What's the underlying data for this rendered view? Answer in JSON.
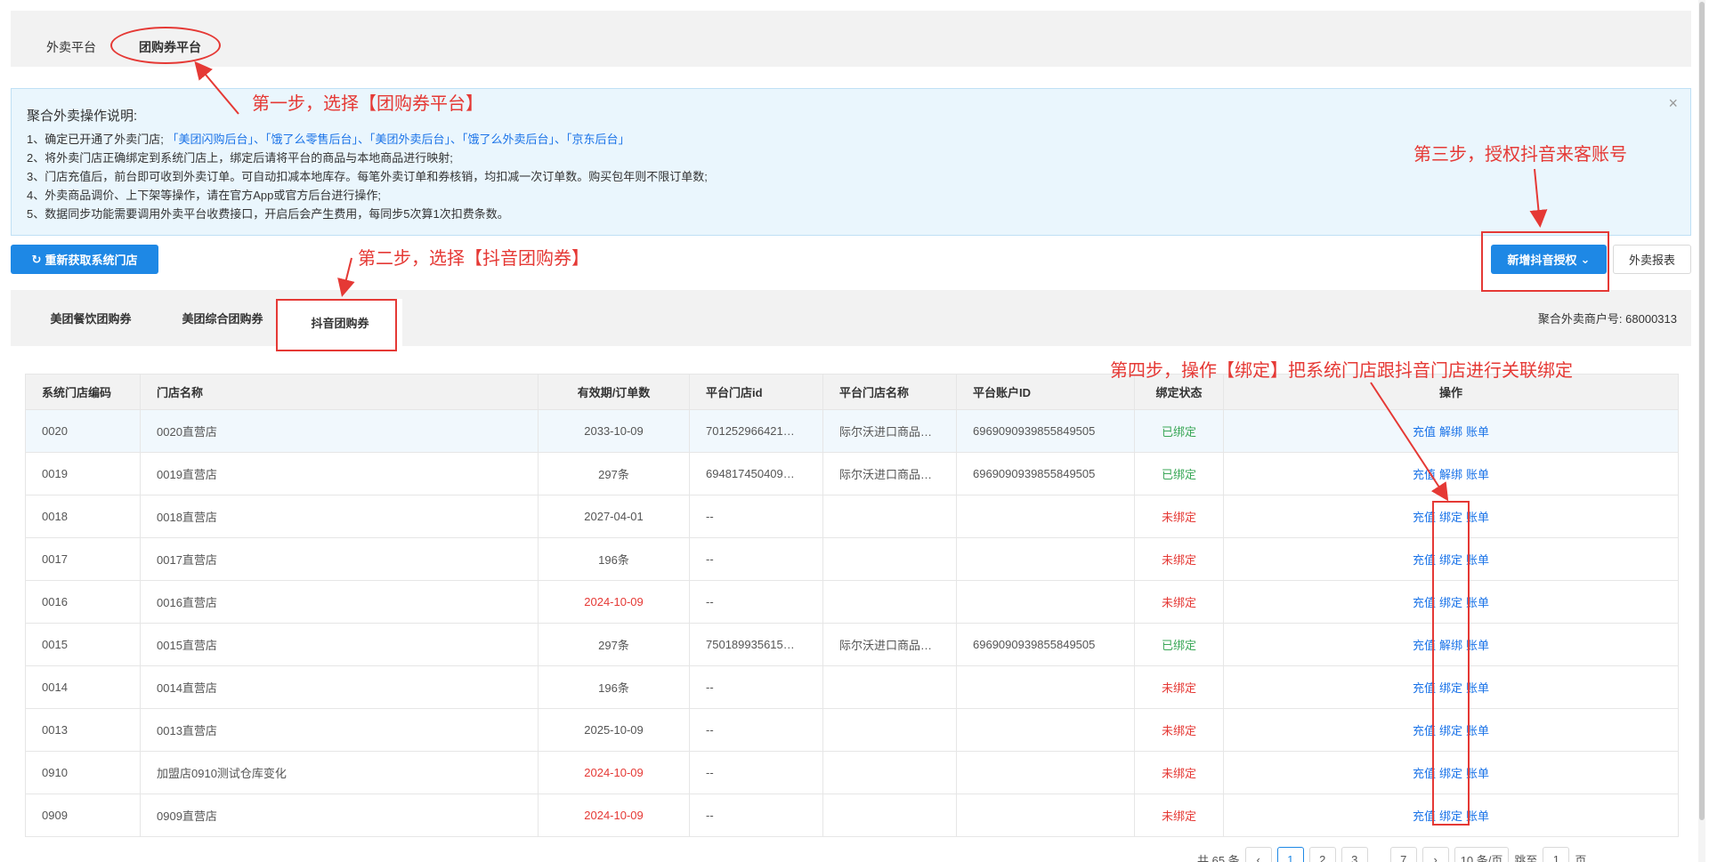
{
  "top_tabs": {
    "waimai": "外卖平台",
    "tuangou": "团购券平台"
  },
  "notice": {
    "title": "聚合外卖操作说明:",
    "close": "×",
    "line1_prefix": "1、确定已开通了外卖门店;",
    "line1_links": "「美团闪购后台」、「饿了么零售后台」、「美团外卖后台」、「饿了么外卖后台」、「京东后台」",
    "line2": "2、将外卖门店正确绑定到系统门店上，绑定后请将平台的商品与本地商品进行映射;",
    "line3": "3、门店充值后，前台即可收到外卖订单。可自动扣减本地库存。每笔外卖订单和券核销，均扣减一次订单数。购买包年则不限订单数;",
    "line4": "4、外卖商品调价、上下架等操作，请在官方App或官方后台进行操作;",
    "line5": "5、数据同步功能需要调用外卖平台收费接口，开启后会产生费用，每同步5次算1次扣费条数。"
  },
  "buttons": {
    "refresh": "重新获取系统门店",
    "add_auth": "新增抖音授权",
    "report": "外卖报表"
  },
  "sub_tabs": {
    "meituan_food": "美团餐饮团购券",
    "meituan_all": "美团综合团购券",
    "douyin": "抖音团购券"
  },
  "merchant_label": "聚合外卖商户号: 68000313",
  "table": {
    "headers": [
      "系统门店编码",
      "门店名称",
      "有效期/订单数",
      "平台门店id",
      "平台门店名称",
      "平台账户ID",
      "绑定状态",
      "操作"
    ],
    "rows": [
      {
        "code": "0020",
        "name": "0020直营店",
        "validity": "2033-10-09",
        "validity_red": false,
        "pid": "701252966421…",
        "pname": "际尔沃进口商品…",
        "acct": "6969090939855849505",
        "status": "已绑定",
        "bound": true
      },
      {
        "code": "0019",
        "name": "0019直营店",
        "validity": "297条",
        "validity_red": false,
        "pid": "694817450409…",
        "pname": "际尔沃进口商品…",
        "acct": "6969090939855849505",
        "status": "已绑定",
        "bound": true
      },
      {
        "code": "0018",
        "name": "0018直营店",
        "validity": "2027-04-01",
        "validity_red": false,
        "pid": "--",
        "pname": "",
        "acct": "",
        "status": "未绑定",
        "bound": false
      },
      {
        "code": "0017",
        "name": "0017直营店",
        "validity": "196条",
        "validity_red": false,
        "pid": "--",
        "pname": "",
        "acct": "",
        "status": "未绑定",
        "bound": false
      },
      {
        "code": "0016",
        "name": "0016直营店",
        "validity": "2024-10-09",
        "validity_red": true,
        "pid": "--",
        "pname": "",
        "acct": "",
        "status": "未绑定",
        "bound": false
      },
      {
        "code": "0015",
        "name": "0015直营店",
        "validity": "297条",
        "validity_red": false,
        "pid": "750189935615…",
        "pname": "际尔沃进口商品…",
        "acct": "6969090939855849505",
        "status": "已绑定",
        "bound": true
      },
      {
        "code": "0014",
        "name": "0014直营店",
        "validity": "196条",
        "validity_red": false,
        "pid": "--",
        "pname": "",
        "acct": "",
        "status": "未绑定",
        "bound": false
      },
      {
        "code": "0013",
        "name": "0013直营店",
        "validity": "2025-10-09",
        "validity_red": false,
        "pid": "--",
        "pname": "",
        "acct": "",
        "status": "未绑定",
        "bound": false
      },
      {
        "code": "0910",
        "name": "加盟店0910测试仓库变化",
        "validity": "2024-10-09",
        "validity_red": true,
        "pid": "--",
        "pname": "",
        "acct": "",
        "status": "未绑定",
        "bound": false
      },
      {
        "code": "0909",
        "name": "0909直营店",
        "validity": "2024-10-09",
        "validity_red": true,
        "pid": "--",
        "pname": "",
        "acct": "",
        "status": "未绑定",
        "bound": false
      }
    ],
    "ops": {
      "recharge": "充值",
      "bind": "绑定",
      "unbind": "解绑",
      "bill": "账单"
    }
  },
  "pager": {
    "total": "共 65 条",
    "prev": "‹",
    "pages": [
      "1",
      "2",
      "3"
    ],
    "ellipsis": "…",
    "last": "7",
    "next": "›",
    "size": "10 条/页",
    "jump_label": "跳至",
    "jump_value": "1",
    "page_unit": "页"
  },
  "annotations": {
    "step1": "第一步，选择【团购券平台】",
    "step2": "第二步，选择【抖音团购券】",
    "step3": "第三步，授权抖音来客账号",
    "step4": "第四步，操作【绑定】把系统门店跟抖音门店进行关联绑定"
  },
  "colors": {
    "primary": "#1e88e5",
    "danger": "#e53935",
    "success": "#3aa757",
    "link": "#1a73e8"
  }
}
